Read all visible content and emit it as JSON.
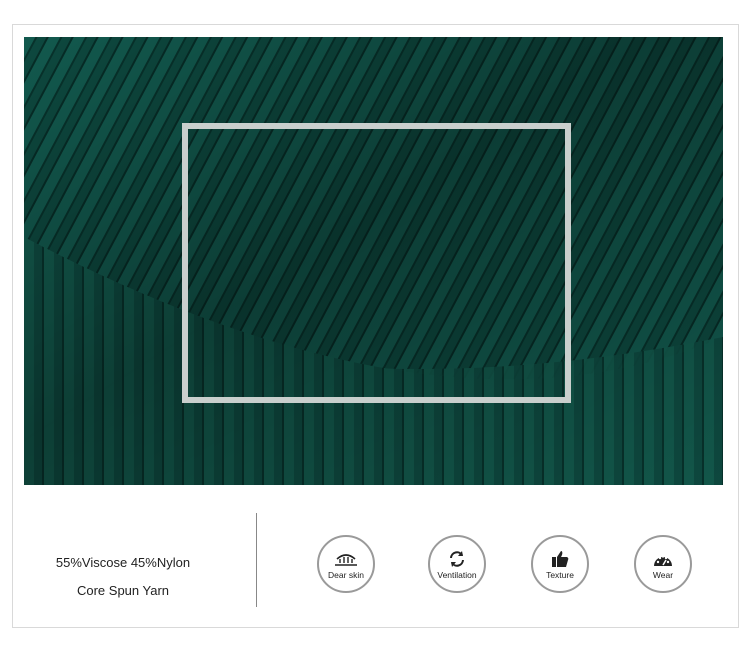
{
  "material": {
    "composition": "55%Viscose 45%Nylon",
    "yarn": "Core Spun Yarn"
  },
  "features": [
    {
      "label": "Dear skin",
      "icon": "skin-icon"
    },
    {
      "label": "Ventilation",
      "icon": "ventilation-icon"
    },
    {
      "label": "Texture",
      "icon": "thumbs-up-icon"
    },
    {
      "label": "Wear",
      "icon": "gauge-icon"
    }
  ],
  "colors": {
    "fabric": "#0d4a40",
    "zoom_frame": "#c9cfcd"
  }
}
